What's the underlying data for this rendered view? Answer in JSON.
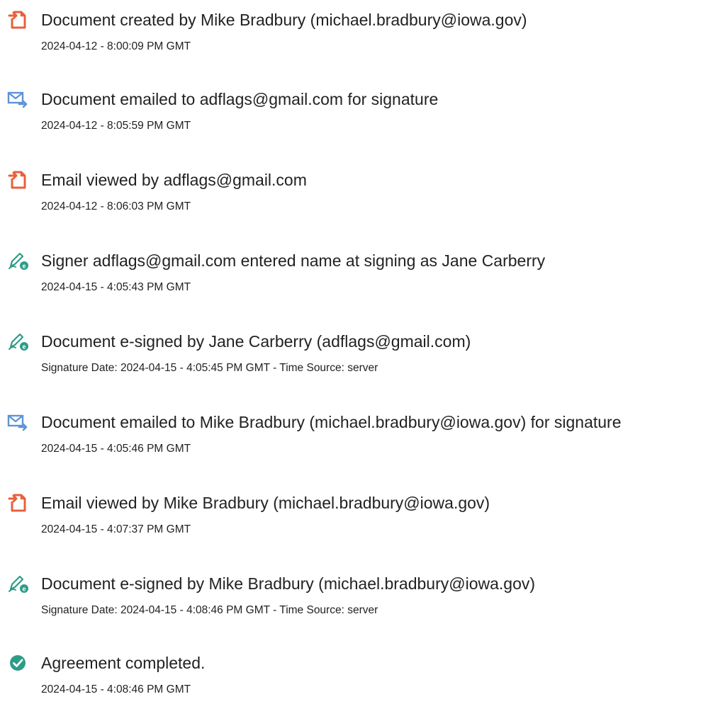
{
  "colors": {
    "document_icon": "#e8603c",
    "email_icon": "#5d94d6",
    "sign_icon": "#2e9c88",
    "complete_icon": "#2e9c88"
  },
  "events": [
    {
      "icon": "document-icon",
      "title": "Document created by Mike Bradbury (michael.bradbury@iowa.gov)",
      "detail": "2024-04-12 - 8:00:09 PM GMT"
    },
    {
      "icon": "email-sent-icon",
      "title": "Document emailed to adflags@gmail.com for signature",
      "detail": "2024-04-12 - 8:05:59 PM GMT"
    },
    {
      "icon": "document-icon",
      "title": "Email viewed by adflags@gmail.com",
      "detail": "2024-04-12 - 8:06:03 PM GMT"
    },
    {
      "icon": "esign-pen-icon",
      "title": "Signer adflags@gmail.com entered name at signing as Jane Carberry",
      "detail": "2024-04-15 - 4:05:43 PM GMT"
    },
    {
      "icon": "esign-pen-icon",
      "title": "Document e-signed by Jane Carberry (adflags@gmail.com)",
      "detail": "Signature Date: 2024-04-15 - 4:05:45 PM GMT - Time Source: server"
    },
    {
      "icon": "email-sent-icon",
      "title": "Document emailed to Mike Bradbury (michael.bradbury@iowa.gov) for signature",
      "detail": "2024-04-15 - 4:05:46 PM GMT"
    },
    {
      "icon": "document-icon",
      "title": "Email viewed by Mike Bradbury (michael.bradbury@iowa.gov)",
      "detail": "2024-04-15 - 4:07:37 PM GMT"
    },
    {
      "icon": "esign-pen-icon",
      "title": "Document e-signed by Mike Bradbury (michael.bradbury@iowa.gov)",
      "detail": "Signature Date: 2024-04-15 - 4:08:46 PM GMT - Time Source: server"
    },
    {
      "icon": "checkmark-circle-icon",
      "title": "Agreement completed.",
      "detail": "2024-04-15 - 4:08:46 PM GMT"
    }
  ]
}
